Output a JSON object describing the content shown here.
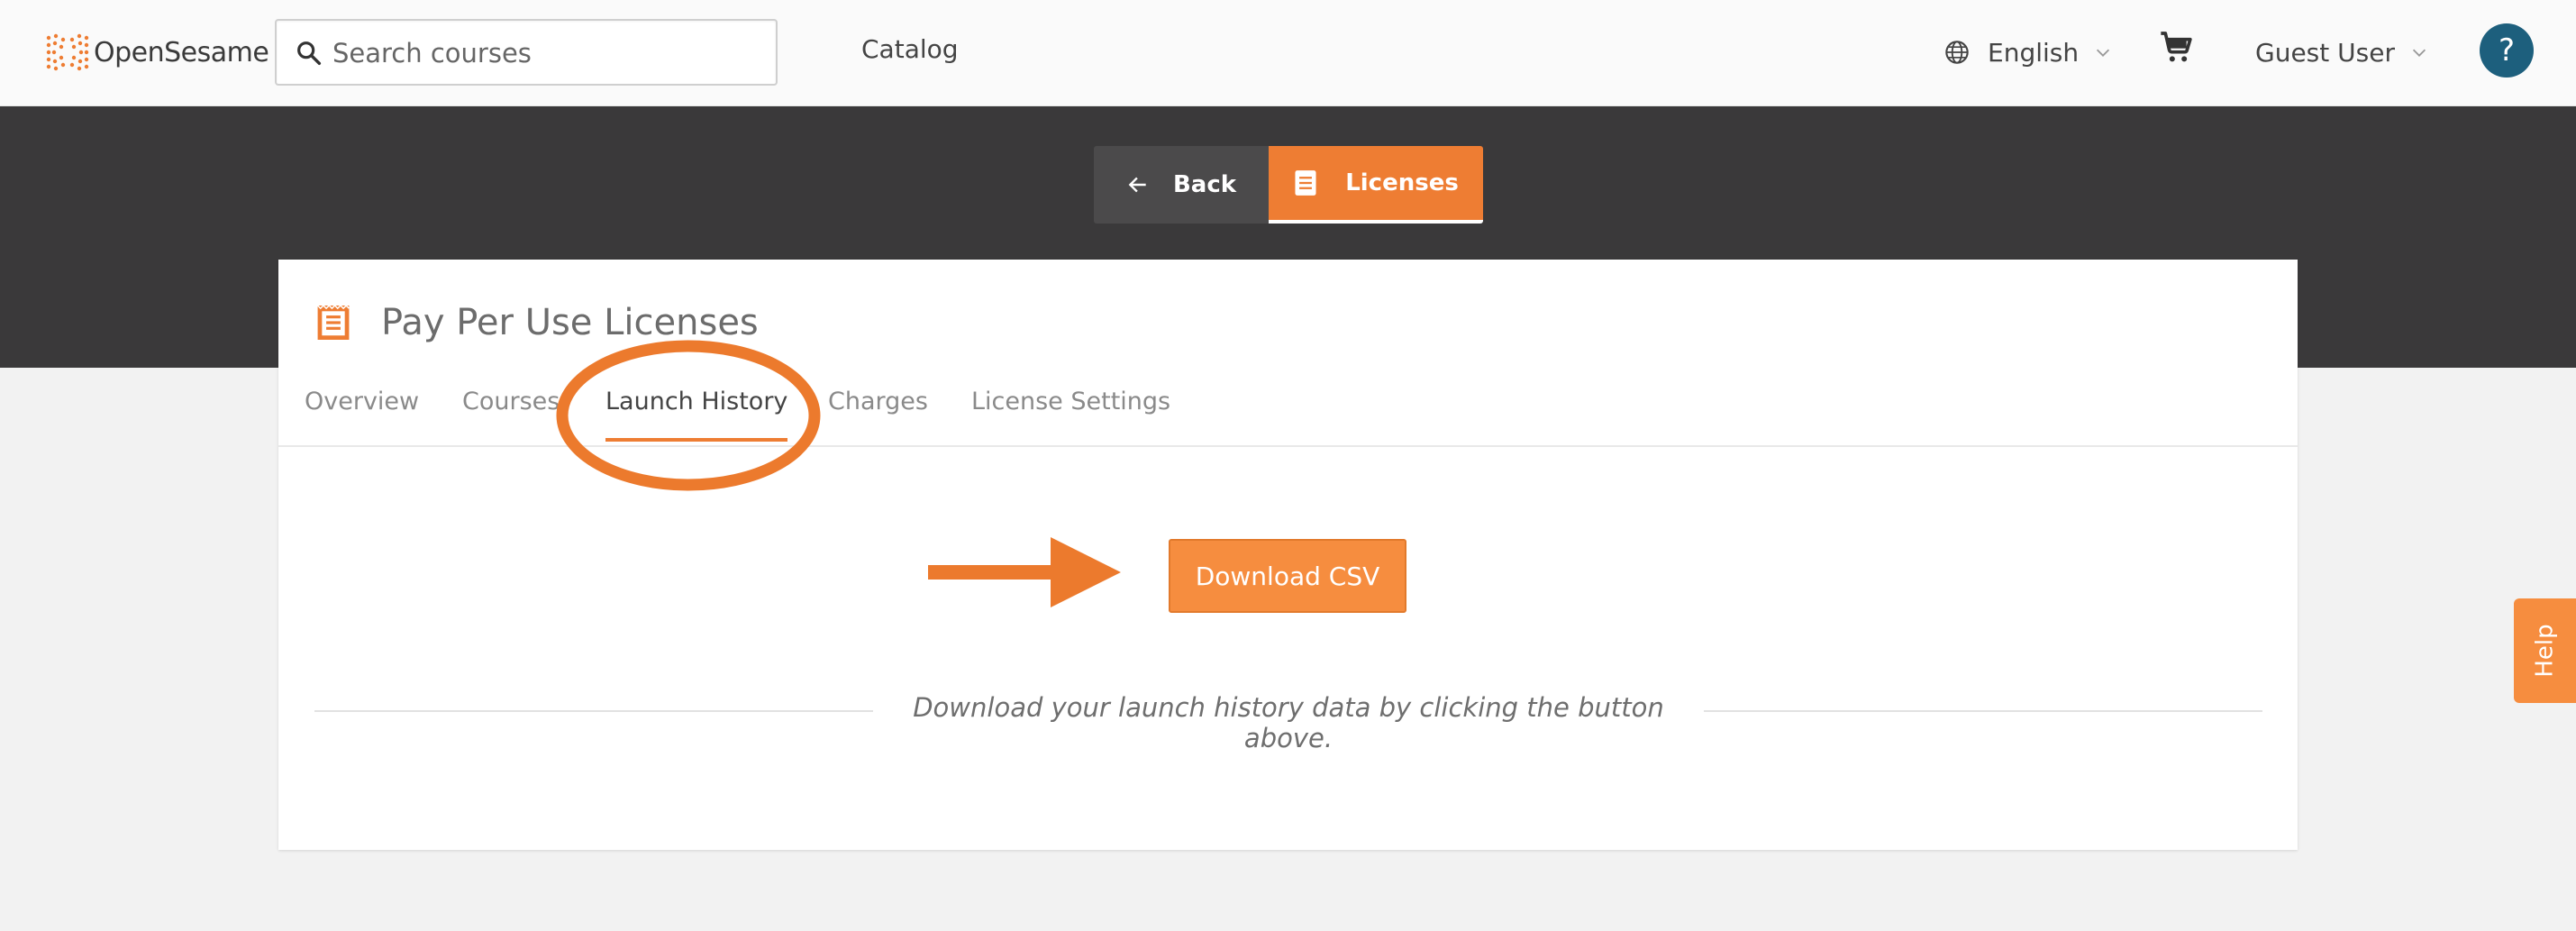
{
  "header": {
    "logo_text": "OpenSesame",
    "search_placeholder": "Search courses",
    "nav_catalog": "Catalog",
    "language": "English",
    "user": "Guest User",
    "help_glyph": "?"
  },
  "band": {
    "back_label": "Back",
    "licenses_label": "Licenses"
  },
  "card": {
    "title": "Pay Per Use Licenses",
    "tabs": [
      {
        "label": "Overview",
        "active": false
      },
      {
        "label": "Courses",
        "active": false
      },
      {
        "label": "Launch History",
        "active": true
      },
      {
        "label": "Charges",
        "active": false
      },
      {
        "label": "License Settings",
        "active": false
      }
    ],
    "download_label": "Download CSV",
    "hint": "Download your launch history data by clicking the button above."
  },
  "side_help": "Help",
  "colors": {
    "accent": "#ee7d33",
    "button": "#f68d3f",
    "dark_band": "#3a393a",
    "help_circle": "#1d5f7d"
  },
  "icons": [
    "search-icon",
    "globe-icon",
    "chevron-down-icon",
    "cart-icon",
    "arrow-left-icon",
    "document-icon"
  ]
}
